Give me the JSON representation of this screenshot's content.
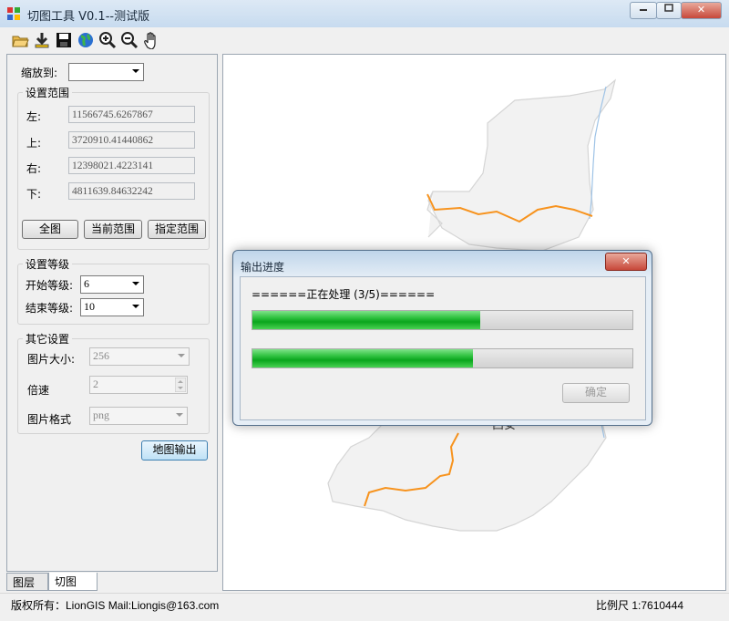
{
  "window": {
    "title": "切图工具 V0.1--测试版",
    "buttons": {
      "minimize": "▭",
      "maximize": "□",
      "close": "✕"
    }
  },
  "toolbar": {
    "icons": [
      "open-folder-icon",
      "add-layer-icon",
      "save-icon",
      "globe-icon",
      "zoom-in-icon",
      "zoom-out-icon",
      "pan-hand-icon"
    ]
  },
  "panel": {
    "zoom_to_label": "缩放到:",
    "zoom_to_value": "",
    "range": {
      "title": "设置范围",
      "left_label": "左:",
      "left_value": "11566745.6267867",
      "top_label": "上:",
      "top_value": "3720910.41440862",
      "right_label": "右:",
      "right_value": "12398021.4223141",
      "bottom_label": "下:",
      "bottom_value": "4811639.84632242",
      "btn_full": "全图",
      "btn_current": "当前范围",
      "btn_specify": "指定范围"
    },
    "level": {
      "title": "设置等级",
      "start_label": "开始等级:",
      "start_value": "6",
      "end_label": "结束等级:",
      "end_value": "10"
    },
    "other": {
      "title": "其它设置",
      "size_label": "图片大小:",
      "size_value": "256",
      "speed_label": "倍速",
      "speed_value": "2",
      "format_label": "图片格式",
      "format_value": "png"
    },
    "export_button": "地图输出"
  },
  "tabs": [
    {
      "label": "图层"
    },
    {
      "label": "切图"
    }
  ],
  "statusbar": {
    "left": "版权所有：LionGIS Mail:Liongis@163.com",
    "right": "比例尺 1:7610444"
  },
  "map": {
    "city_label": "西安",
    "fill": "#f2f2f2",
    "border": "#d5d5d5",
    "road": "#f7931e",
    "river": "#9ec3e6"
  },
  "dialog": {
    "title": "输出进度",
    "close": "✕",
    "status": "======正在处理 (3/5)======",
    "progress1": 0.6,
    "progress2": 0.58,
    "ok_button": "确定"
  },
  "colors": {
    "progress_green": "#1dbb2e"
  }
}
